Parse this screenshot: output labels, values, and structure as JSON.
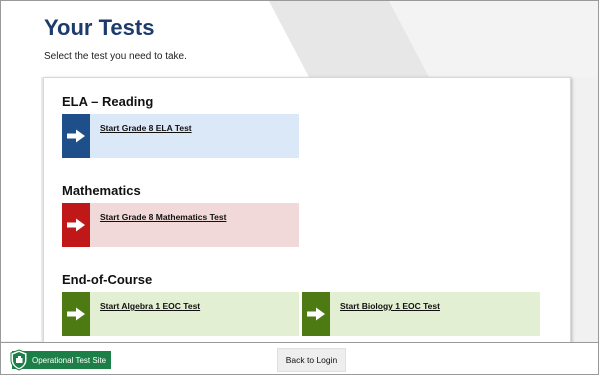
{
  "header": {
    "title": "Your Tests",
    "subtitle": "Select the test you need to take."
  },
  "sections": [
    {
      "title": "ELA – Reading",
      "tests": [
        {
          "label": "Start Grade 8 ELA Test",
          "accent": "#1f4f8a",
          "bg": "#dbe8f7",
          "icon": "arrow-right-icon"
        }
      ]
    },
    {
      "title": "Mathematics",
      "tests": [
        {
          "label": "Start Grade 8 Mathematics Test",
          "accent": "#c01818",
          "bg": "#f2d9d9",
          "icon": "arrow-right-icon"
        }
      ]
    },
    {
      "title": "End-of-Course",
      "tests": [
        {
          "label": "Start Algebra 1 EOC Test",
          "accent": "#4e7a14",
          "bg": "#e3efd2",
          "icon": "arrow-right-icon"
        },
        {
          "label": "Start Biology 1 EOC Test",
          "accent": "#4e7a14",
          "bg": "#e3efd2",
          "icon": "arrow-right-icon"
        }
      ]
    }
  ],
  "footer": {
    "site_label": "Operational Test Site",
    "site_icon": "shield-icon",
    "site_color": "#1d7f48",
    "back_label": "Back to Login"
  },
  "colors": {
    "title": "#1d3b6b",
    "background": "#efefef"
  }
}
